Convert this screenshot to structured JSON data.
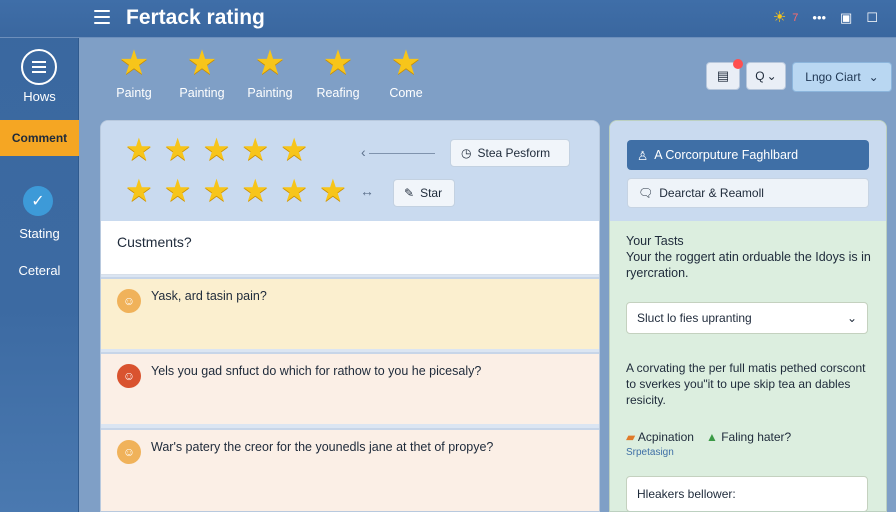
{
  "header": {
    "title": "Fertack rating",
    "icons": [
      "sun-icon",
      "notification-count",
      "more-icon",
      "window-icon",
      "close-icon"
    ],
    "notification_count": "7"
  },
  "sidebar": {
    "items": [
      {
        "label": "Hows",
        "icon": "list-icon"
      },
      {
        "label": "Comment",
        "active": true
      },
      {
        "label": "Stating",
        "icon": "check-icon"
      },
      {
        "label": "Ceteral"
      }
    ]
  },
  "toolbar": {
    "star_items": [
      {
        "label": "Paintg"
      },
      {
        "label": "Painting"
      },
      {
        "label": "Painting"
      },
      {
        "label": "Reafing"
      },
      {
        "label": "Come"
      }
    ],
    "login_label": "Lngo Ciart",
    "search_glyph": "Q"
  },
  "rating": {
    "row1_stars": 5,
    "row2_stars": 6,
    "chip1": "Stea Pesform",
    "chip2": "Star"
  },
  "comments": {
    "header": "Custments?",
    "items": [
      {
        "text": "Yask, ard tasin pain?",
        "bg": "#fbefcf",
        "avatar": "#f0b25a"
      },
      {
        "text": "Yels you gad snfuct do which for rathow to you he picesaly?",
        "bg": "#fbefe6",
        "avatar": "#d9532f"
      },
      {
        "text": "War's patery the creor for the younedls jane at thet of propye?",
        "bg": "#fbefe6",
        "avatar": "#f0b25a"
      }
    ]
  },
  "right_panel": {
    "primary_button": "A Corcorputure Faghlbard",
    "secondary_button": "Dearctar & Reamoll",
    "heading": "Your Tasts",
    "description": "Your the roggert atin orduable the Idoys is in ryercration.",
    "select_value": "Sluct lo fies upranting",
    "paragraph": "A corvating the per full matis pethed corscont to sverkes you\"it to upe skip tea an dables resicity.",
    "action1": "Acpination",
    "action2": "Faling hater?",
    "sub_link": "Srpetasign",
    "bottom_text": "Hleakers bellower:"
  },
  "colors": {
    "accent": "#f5a623",
    "primary": "#3f6fa6",
    "star": "#f7c51a"
  }
}
